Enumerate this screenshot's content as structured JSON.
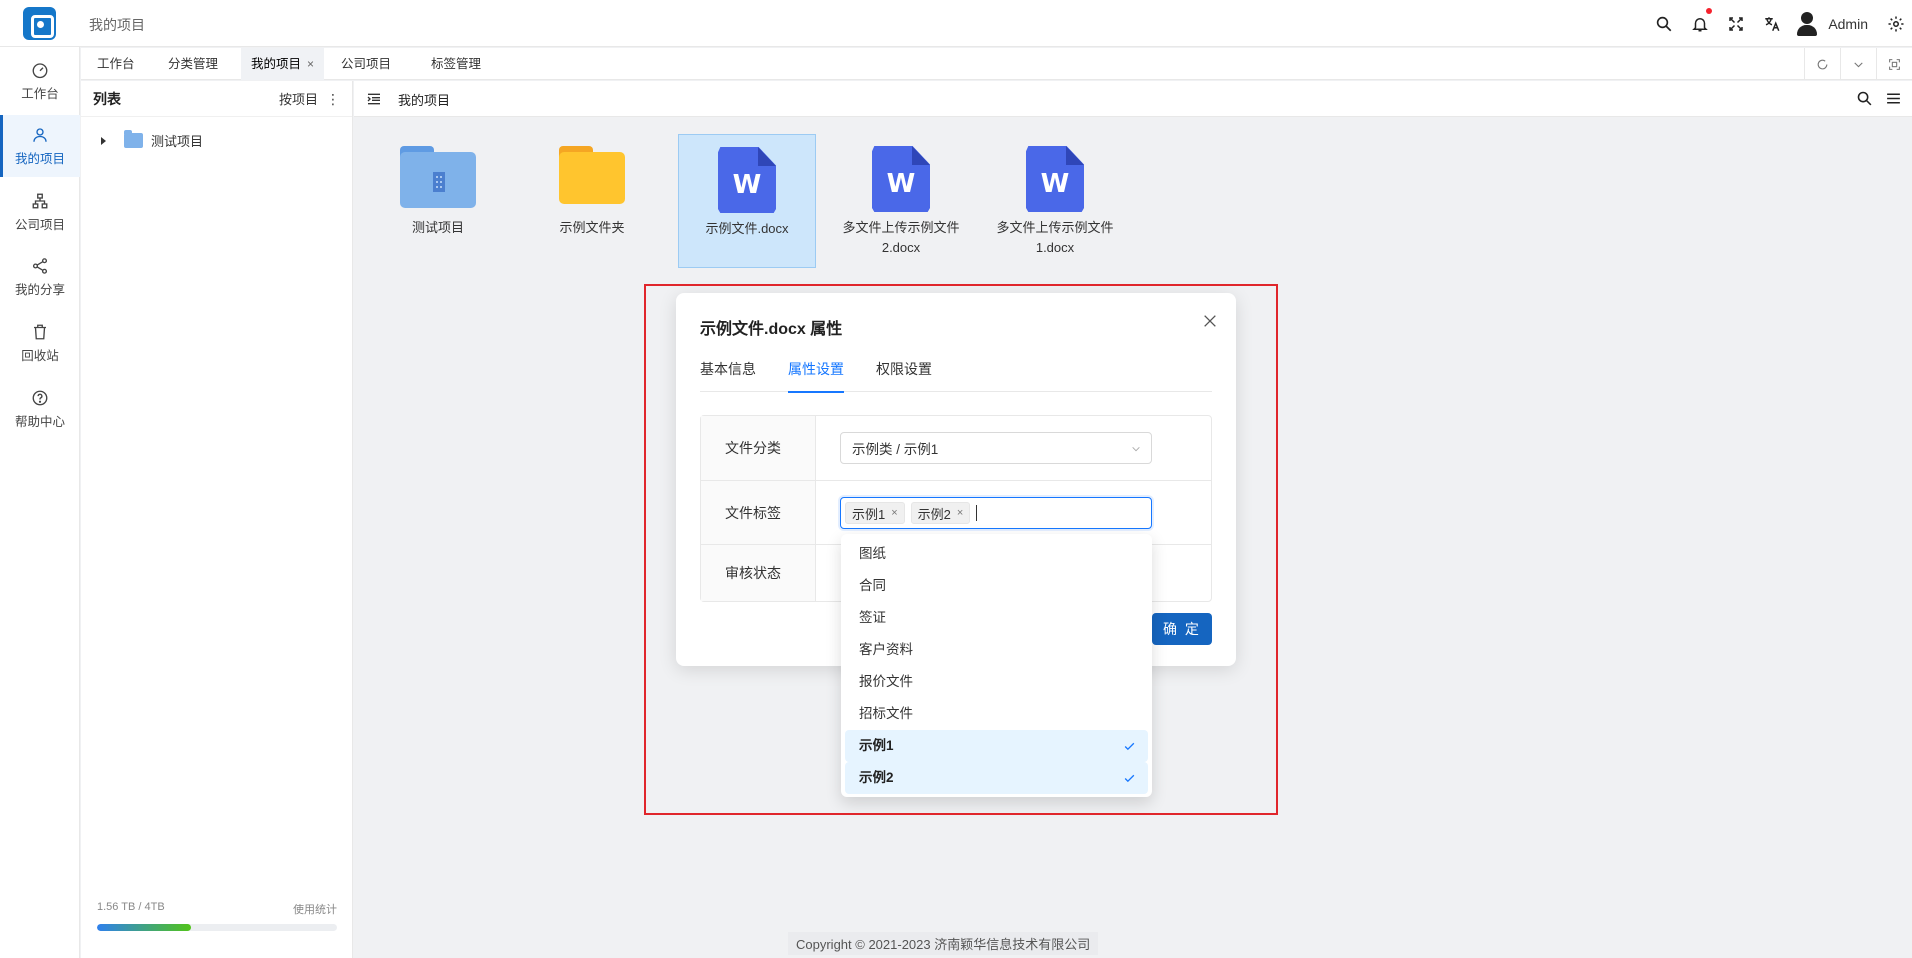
{
  "header": {
    "title": "我的项目",
    "user_name": "Admin",
    "icons": [
      "search-icon",
      "bell-icon",
      "fullscreen-icon",
      "translate-icon",
      "user-avatar",
      "gear-icon"
    ]
  },
  "sidebar": {
    "items": [
      {
        "label": "工作台",
        "icon": "dashboard-icon",
        "active": false
      },
      {
        "label": "我的项目",
        "icon": "user-icon",
        "active": true
      },
      {
        "label": "公司项目",
        "icon": "org-chart-icon",
        "active": false
      },
      {
        "label": "我的分享",
        "icon": "share-icon",
        "active": false
      },
      {
        "label": "回收站",
        "icon": "trash-icon",
        "active": false
      },
      {
        "label": "帮助中心",
        "icon": "help-icon",
        "active": false
      }
    ]
  },
  "tabs": [
    {
      "label": "工作台"
    },
    {
      "label": "分类管理"
    },
    {
      "label": "我的项目",
      "active": true,
      "close": "×"
    },
    {
      "label": "公司项目"
    },
    {
      "label": "标签管理"
    }
  ],
  "tree": {
    "title": "列表",
    "sort_label": "按项目",
    "node_label": "测试项目",
    "storage_text": "1.56 TB / 4TB",
    "usage_link": "使用统计",
    "usage_fraction": 0.39
  },
  "main": {
    "title": "我的项目",
    "files": [
      {
        "name": "测试项目",
        "type": "project-folder"
      },
      {
        "name": "示例文件夹",
        "type": "folder"
      },
      {
        "name": "示例文件.docx",
        "type": "word",
        "selected": true
      },
      {
        "name": "多文件上传示例文件2.docx",
        "type": "word"
      },
      {
        "name": "多文件上传示例文件1.docx",
        "type": "word"
      }
    ],
    "word_letter": "W"
  },
  "dialog": {
    "title": "示例文件.docx 属性",
    "tabs": [
      {
        "label": "基本信息"
      },
      {
        "label": "属性设置",
        "active": true
      },
      {
        "label": "权限设置"
      }
    ],
    "fields": {
      "category_label": "文件分类",
      "category_value": "示例类 / 示例1",
      "tags_label": "文件标签",
      "tags": [
        "示例1",
        "示例2"
      ],
      "tag_remove": "×",
      "review_label": "审核状态"
    },
    "ok_label": "确 定"
  },
  "dropdown": {
    "options": [
      {
        "label": "图纸",
        "selected": false
      },
      {
        "label": "合同",
        "selected": false
      },
      {
        "label": "签证",
        "selected": false
      },
      {
        "label": "客户资料",
        "selected": false
      },
      {
        "label": "报价文件",
        "selected": false
      },
      {
        "label": "招标文件",
        "selected": false
      },
      {
        "label": "示例1",
        "selected": true
      },
      {
        "label": "示例2",
        "selected": true
      }
    ]
  },
  "footer": {
    "copyright": "Copyright © 2021-2023 济南颖华信息技术有限公司"
  },
  "colors": {
    "primary": "#1565c0",
    "accent_blue": "#1677ff",
    "highlight_red": "#e0262b",
    "word_blue": "#4a68e8",
    "folder_yellow": "#ffc52e",
    "project_folder_blue": "#7fb2ea"
  }
}
